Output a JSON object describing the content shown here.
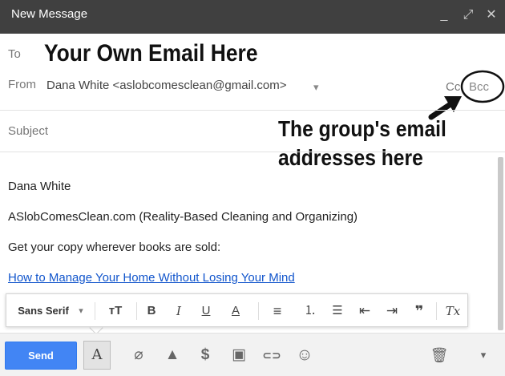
{
  "window": {
    "title": "New Message",
    "minimize_glyph": "_",
    "popout_glyph": "⤢",
    "close_glyph": "✕"
  },
  "header": {
    "to_label": "To",
    "to_annotation": "Your Own Email Here",
    "from_label": "From",
    "from_value": "Dana White <aslobcomesclean@gmail.com>",
    "from_dropdown_glyph": "▾",
    "cc_label": "Cc",
    "bcc_label": "Bcc",
    "subject_placeholder": "Subject",
    "bcc_annotation_line1": "The group's email",
    "bcc_annotation_line2": "addresses here"
  },
  "body": {
    "line1": "Dana White",
    "line2": "ASlobComesClean.com (Reality-Based Cleaning and Organizing)",
    "line3": "Get your copy wherever books are sold:",
    "link": "How to Manage Your Home Without Losing Your Mind "
  },
  "format_toolbar": {
    "font_family": "Sans Serif",
    "font_dropdown_glyph": "▾",
    "size_glyph": "тT",
    "bold": "B",
    "italic": "I",
    "underline": "U",
    "text_color": "A",
    "align_glyph": "≡",
    "numbered_list_glyph": "⒈",
    "bulleted_list_glyph": "☰",
    "indent_less_glyph": "⇤",
    "indent_more_glyph": "⇥",
    "quote_glyph": "❞",
    "clear_format_glyph": "Tx"
  },
  "bottom_bar": {
    "send_label": "Send",
    "formatting_toggle": "A",
    "attach_glyph": "⌀",
    "drive_glyph": "▲",
    "money_glyph": "$",
    "photo_glyph": "▣",
    "link_glyph": "⊂⊃",
    "emoji_glyph": "☺",
    "trash_glyph": "🗑",
    "more_glyph": "▾"
  },
  "colors": {
    "titlebar": "#404040",
    "send_button": "#4285f4",
    "link": "#1155cc"
  }
}
